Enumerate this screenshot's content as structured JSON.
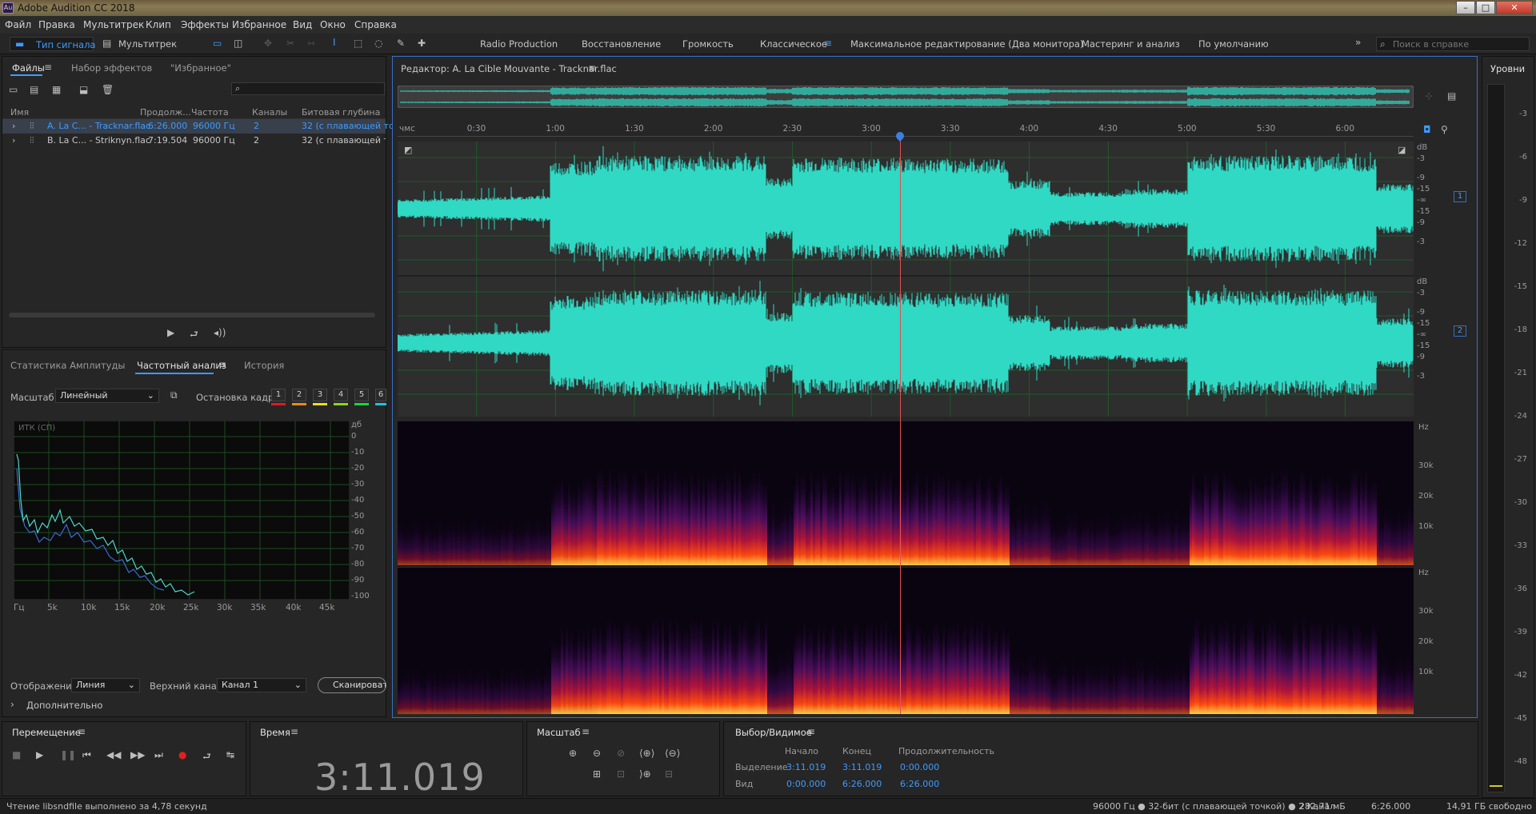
{
  "app_title": "Adobe Audition CC 2018",
  "menu": [
    "Файл",
    "Правка",
    "Мультитрек",
    "Клип",
    "Эффекты",
    "Избранное",
    "Вид",
    "Окно",
    "Справка"
  ],
  "toolbar": {
    "waveform_label": "Тип сигнала",
    "multitrack_label": "Мультитрек",
    "workspaces": [
      "Radio Production",
      "Восстановление",
      "Громкость",
      "Классическое",
      "Максимальное редактирование (Два монитора)",
      "Мастеринг и анализ",
      "По умолчанию"
    ],
    "active_workspace": "Классическое",
    "search_placeholder": "Поиск в справке"
  },
  "files_panel": {
    "tab_files": "Файлы",
    "tab_effects": "Набор эффектов",
    "tab_favorites": "\"Избранное\"",
    "columns": [
      "Имя",
      "Продолж...",
      "Частота",
      "Каналы",
      "Битовая глубина"
    ],
    "rows": [
      {
        "name": "A. La C... - Tracknar.flac",
        "duration": "6:26.000",
        "rate": "96000 Гц",
        "channels": "2",
        "depth": "32 (с плавающей точ"
      },
      {
        "name": "B. La C... - Striknyn.flac",
        "duration": "7:19.504",
        "rate": "96000 Гц",
        "channels": "2",
        "depth": "32 (с плавающей точ"
      }
    ]
  },
  "analysis_panel": {
    "tab_amp": "Статистика Амплитуды",
    "tab_freq": "Частотный анализ",
    "tab_history": "История",
    "scale_label": "Масштаб:",
    "scale_value": "Линейный",
    "freeze_label": "Остановка кадра:",
    "freeze_slots": [
      "1",
      "2",
      "3",
      "4",
      "5",
      "6"
    ],
    "freeze_colors": [
      "#e21b1b",
      "#e88b1a",
      "#e8e01a",
      "#8bd61a",
      "#1ad63a",
      "#1ac3e8"
    ],
    "graph_title": "ИТК (СП)",
    "db_label": "дб",
    "db_ticks": [
      "0",
      "-10",
      "-20",
      "-30",
      "-40",
      "-50",
      "-60",
      "-70",
      "-80",
      "-90",
      "-100"
    ],
    "freq_ticks": [
      "Гц",
      "5k",
      "10k",
      "15k",
      "20k",
      "25k",
      "30k",
      "35k",
      "40k",
      "45k"
    ],
    "display_label": "Отображение:",
    "display_value": "Линия",
    "channel_label": "Верхний канал:",
    "channel_value": "Канал 1",
    "scan_button": "Сканировать",
    "advanced_label": "Дополнительно"
  },
  "editor": {
    "title": "Редактор: A. La Cible Mouvante - Tracknar.flac",
    "ruler_unit": "чмс",
    "ruler_ticks": [
      "0:30",
      "1:00",
      "1:30",
      "2:00",
      "2:30",
      "3:00",
      "3:30",
      "4:00",
      "4:30",
      "5:00",
      "5:30",
      "6:00"
    ],
    "db_scale": [
      "dB",
      "-3",
      "-9",
      "-15",
      "-∞",
      "-15",
      "-9",
      "-3"
    ],
    "channel_badges": [
      "1",
      "2"
    ],
    "hz_label": "Hz",
    "hz_ticks": [
      "30k",
      "20k",
      "10k"
    ],
    "playhead_seconds": 191.019,
    "total_seconds": 386,
    "waveform_color": "#2fd9c4"
  },
  "levels": {
    "title": "Уровни",
    "ticks": [
      "-3",
      "-6",
      "-9",
      "-12",
      "-15",
      "-18",
      "-21",
      "-24",
      "-27",
      "-30",
      "-33",
      "-36",
      "-39",
      "-42",
      "-45",
      "-48"
    ]
  },
  "transport": {
    "title": "Перемещение"
  },
  "time_panel": {
    "title": "Время",
    "value": "3:11.019"
  },
  "zoom_panel": {
    "title": "Масштаб"
  },
  "selection_panel": {
    "title": "Выбор/Видимое",
    "col_start": "Начало",
    "col_end": "Конец",
    "col_duration": "Продолжительность",
    "row_selection": "Выделение",
    "row_view": "Вид",
    "sel_start": "3:11.019",
    "sel_end": "3:11.019",
    "sel_duration": "0:00.000",
    "view_start": "0:00.000",
    "view_end": "6:26.000",
    "view_duration": "6:26.000"
  },
  "status": {
    "message": "Чтение libsndfile выполнено за 4,78 секунд",
    "format": "96000 Гц ● 32-бит (с плавающей точкой) ● 2 Канал",
    "size": "282,71 мБ",
    "duration": "6:26.000",
    "free": "14,91 ГБ свободно"
  }
}
